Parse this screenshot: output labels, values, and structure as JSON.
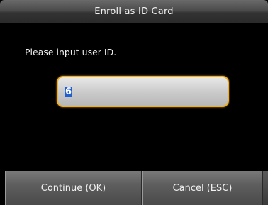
{
  "title_bar": {
    "title": "Enroll as ID Card"
  },
  "main": {
    "prompt": "Please input user ID.",
    "user_id_input": {
      "value": "6"
    }
  },
  "footer": {
    "continue_label": "Continue (OK)",
    "cancel_label": "Cancel (ESC)"
  },
  "colors": {
    "input_border": "#f0b020",
    "selection_highlight": "#1f5fd0",
    "background": "#000000"
  }
}
